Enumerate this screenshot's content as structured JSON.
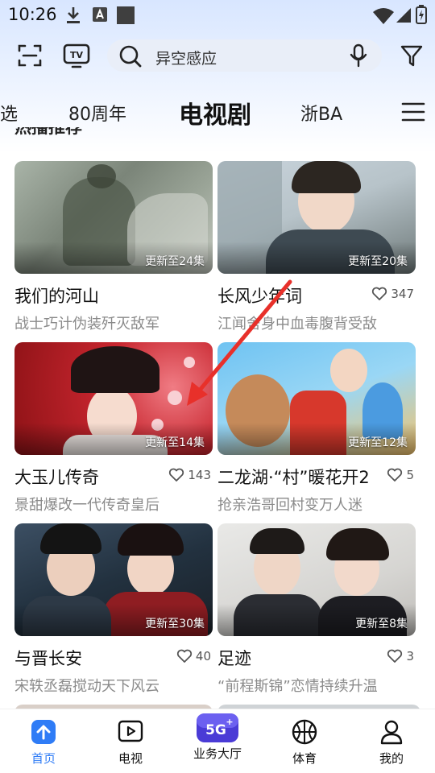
{
  "status_bar": {
    "time": "10:26"
  },
  "search": {
    "query": "异空感应"
  },
  "tabs": [
    {
      "label": "选"
    },
    {
      "label": "80周年"
    },
    {
      "label": "电视剧"
    },
    {
      "label": "浙BA"
    }
  ],
  "section": {
    "title": "热播推荐"
  },
  "cards": [
    {
      "title": "我们的河山",
      "subtitle": "战士巧计伪装歼灭敌军",
      "badge": "更新至24集",
      "likes": ""
    },
    {
      "title": "长风少年词",
      "subtitle": "江闻舍身中血毒腹背受敌",
      "badge": "更新至20集",
      "likes": "347"
    },
    {
      "title": "大玉儿传奇",
      "subtitle": "景甜爆改一代传奇皇后",
      "badge": "更新至14集",
      "likes": "143"
    },
    {
      "title": "二龙湖·“村”暖花开2",
      "subtitle": "抢亲浩哥回村变万人迷",
      "badge": "更新至12集",
      "likes": "5"
    },
    {
      "title": "与晋长安",
      "subtitle": "宋轶丞磊搅动天下风云",
      "badge": "更新至30集",
      "likes": "40"
    },
    {
      "title": "足迹",
      "subtitle": "“前程斯锦”恋情持续升温",
      "badge": "更新至8集",
      "likes": "3"
    }
  ],
  "bottom_nav": [
    {
      "label": "首页",
      "icon": "home-arrow-icon"
    },
    {
      "label": "电视",
      "icon": "tv-play-icon"
    },
    {
      "label": "业务大厅",
      "icon": "5g-plus-icon"
    },
    {
      "label": "体育",
      "icon": "basketball-icon"
    },
    {
      "label": "我的",
      "icon": "person-icon"
    }
  ],
  "colors": {
    "accent": "#2f7cf6",
    "annotation_arrow": "#e8302a"
  }
}
